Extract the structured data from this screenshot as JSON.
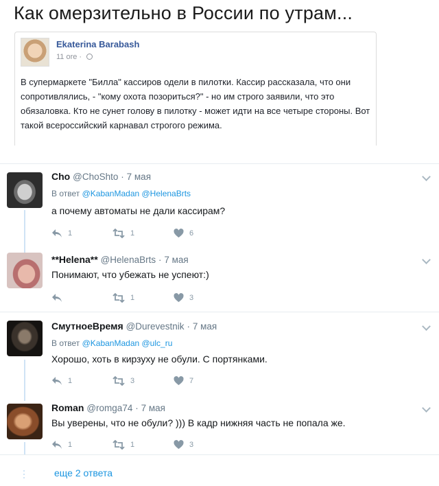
{
  "headline": "Как омерзительно в России по утрам...",
  "quoted_post": {
    "author": "Ekaterina Barabash",
    "time": "11 ore · ",
    "text": "В супермаркете \"Билла\" кассиров одели в пилотки. Кассир рассказала, что они сопротивлялись, - \"кому охота позориться?\" - но им строго заявили, что это обязаловка. Кто не сунет голову в пилотку - может идти на все четыре стороны. Вот такой всероссийский карнавал строгого режима."
  },
  "tweets": [
    {
      "name": "Cho",
      "handle": "@ChoShto",
      "date": "7 мая",
      "reply_prefix": "В ответ ",
      "reply_mentions": "@KabanMadan @HelenaBrts",
      "text": "а почему автоматы не дали кассирам?",
      "replies": "1",
      "retweets": "1",
      "likes": "6"
    },
    {
      "name": "**Helena**",
      "handle": "@HelenaBrts",
      "date": "7 мая",
      "text": "Понимают, что убежать не успеют:)",
      "replies": "",
      "retweets": "1",
      "likes": "3"
    },
    {
      "name": "СмутноеВремя",
      "handle": "@Durevestnik",
      "date": "7 мая",
      "reply_prefix": "В ответ ",
      "reply_mentions": "@KabanMadan @ulc_ru",
      "text": "Хорошо, хоть в кирзуху не обули. С портянками.",
      "replies": "1",
      "retweets": "3",
      "likes": "7"
    },
    {
      "name": "Roman",
      "handle": "@romga74",
      "date": "7 мая",
      "text": "Вы уверены, что не обули? ))) В кадр нижняя часть не попала же.",
      "replies": "1",
      "retweets": "1",
      "likes": "3"
    }
  ],
  "more_replies": "еще 2 ответа",
  "dot": "·",
  "icons": {
    "reply": "reply-icon",
    "retweet": "retweet-icon",
    "like": "heart-icon",
    "menu": "chevron-down-icon"
  },
  "colors": {
    "link": "#1b95e0",
    "muted": "#657786",
    "thread": "#cfe3f5",
    "fb_link": "#365899"
  }
}
